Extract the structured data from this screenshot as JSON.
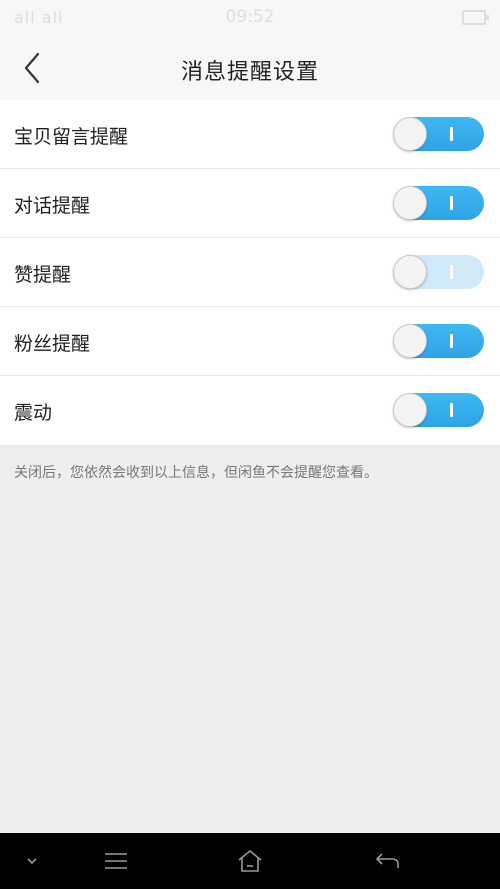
{
  "status_bar": {
    "carrier": "all all",
    "time": "09:52"
  },
  "header": {
    "title": "消息提醒设置"
  },
  "settings": [
    {
      "label": "宝贝留言提醒",
      "state": "on"
    },
    {
      "label": "对话提醒",
      "state": "on"
    },
    {
      "label": "赞提醒",
      "state": "disabled"
    },
    {
      "label": "粉丝提醒",
      "state": "on"
    },
    {
      "label": "震动",
      "state": "on"
    }
  ],
  "hint": "关闭后，您依然会收到以上信息，但闲鱼不会提醒您查看。",
  "colors": {
    "accent": "#2ea3e6",
    "disabled_toggle": "#cfe9f8",
    "background": "#eeeeee"
  },
  "system_nav": {
    "icons": [
      "chevron-down-icon",
      "menu-icon",
      "home-icon",
      "back-icon"
    ]
  }
}
